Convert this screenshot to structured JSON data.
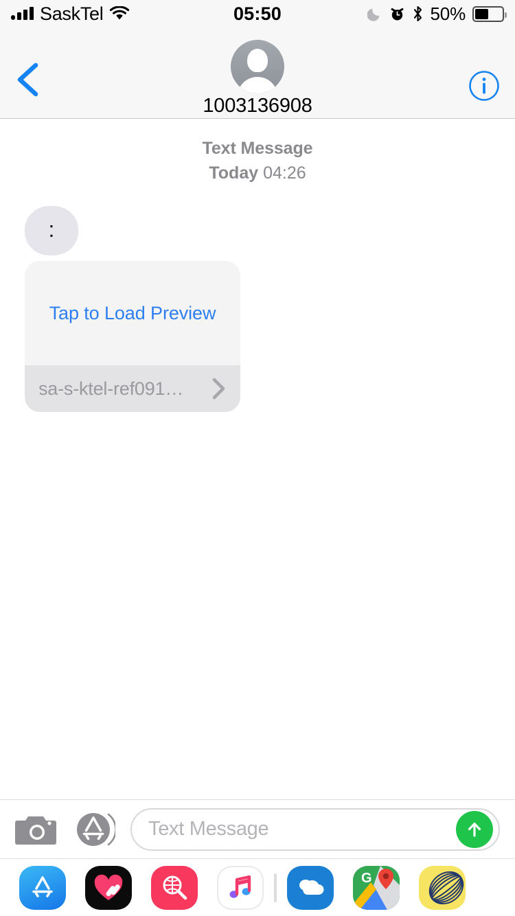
{
  "status_bar": {
    "carrier": "SaskTel",
    "signal_icon": "signal-bars-icon",
    "signal_bars_filled": 4,
    "wifi_icon": "wifi-icon",
    "time": "05:50",
    "dnd_icon": "moon-do-not-disturb-icon",
    "alarm_icon": "alarm-clock-icon",
    "bluetooth_icon": "bluetooth-icon",
    "battery_percent": "50%",
    "battery_level": 50,
    "battery_icon": "battery-icon"
  },
  "nav_bar": {
    "back_icon": "chevron-left-icon",
    "avatar_icon": "contact-avatar-placeholder-icon",
    "contact_name": "1003136908",
    "info_icon": "info-circle-icon"
  },
  "conversation": {
    "message_kind": "Text Message",
    "day_label": "Today",
    "time_label": "04:26",
    "messages": [
      {
        "type": "text",
        "sender": "them",
        "text": ":"
      },
      {
        "type": "link_preview",
        "sender": "them",
        "action_label": "Tap to Load Preview",
        "url_label": "sa-s-ktel-ref091…",
        "chevron_icon": "chevron-right-icon",
        "action_color": "#2D7FF0",
        "top_bg": "#F4F4F4",
        "caption_bg": "#E3E3E5"
      }
    ]
  },
  "input_bar": {
    "camera_icon": "camera-icon",
    "app_store_icon": "app-store-drawer-icon",
    "placeholder": "Text Message",
    "value": "",
    "send_icon": "send-arrow-up-icon",
    "send_color": "#1FC44B"
  },
  "app_drawer": {
    "apps": [
      {
        "name": "app-store",
        "label": "App Store"
      },
      {
        "name": "apple-music-heart",
        "label": "Music"
      },
      {
        "name": "images-search",
        "label": "#images"
      },
      {
        "name": "apple-music",
        "label": "Apple Music"
      },
      {
        "name": "divider",
        "label": ""
      },
      {
        "name": "onedrive",
        "label": "OneDrive"
      },
      {
        "name": "google-maps",
        "label": "Google Maps"
      },
      {
        "name": "yellow-app",
        "label": ""
      }
    ]
  },
  "colors": {
    "ios_blue": "#2D7FF0",
    "bubble_gray": "#E6E5EB",
    "chrome_gray": "#F7F7F7",
    "send_green": "#1FC44B"
  }
}
